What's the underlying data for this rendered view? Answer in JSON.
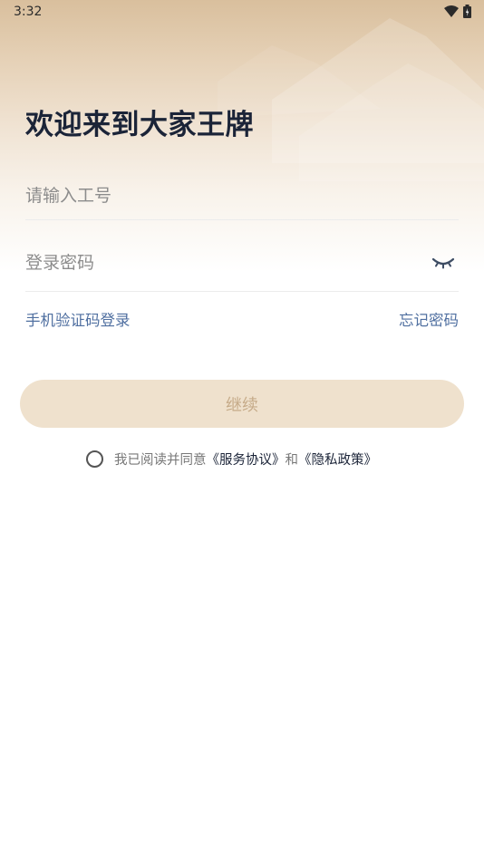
{
  "status_bar": {
    "time": "3:32",
    "wifi_icon": "wifi-icon",
    "battery_icon": "battery-icon"
  },
  "login": {
    "title": "欢迎来到大家王牌",
    "employee_id_placeholder": "请输入工号",
    "password_placeholder": "登录密码",
    "password_toggle_icon": "eye-closed-icon",
    "sms_login_label": "手机验证码登录",
    "forgot_password_label": "忘记密码",
    "continue_label": "继续"
  },
  "agreement": {
    "prefix": "我已阅读并同意",
    "service_link": "《服务协议》",
    "conjunction": "和",
    "privacy_link": "《隐私政策》"
  },
  "colors": {
    "link": "#4f6fa0",
    "button_bg": "#efe1cd",
    "button_text": "#c6ab89",
    "title": "#1b2438"
  }
}
